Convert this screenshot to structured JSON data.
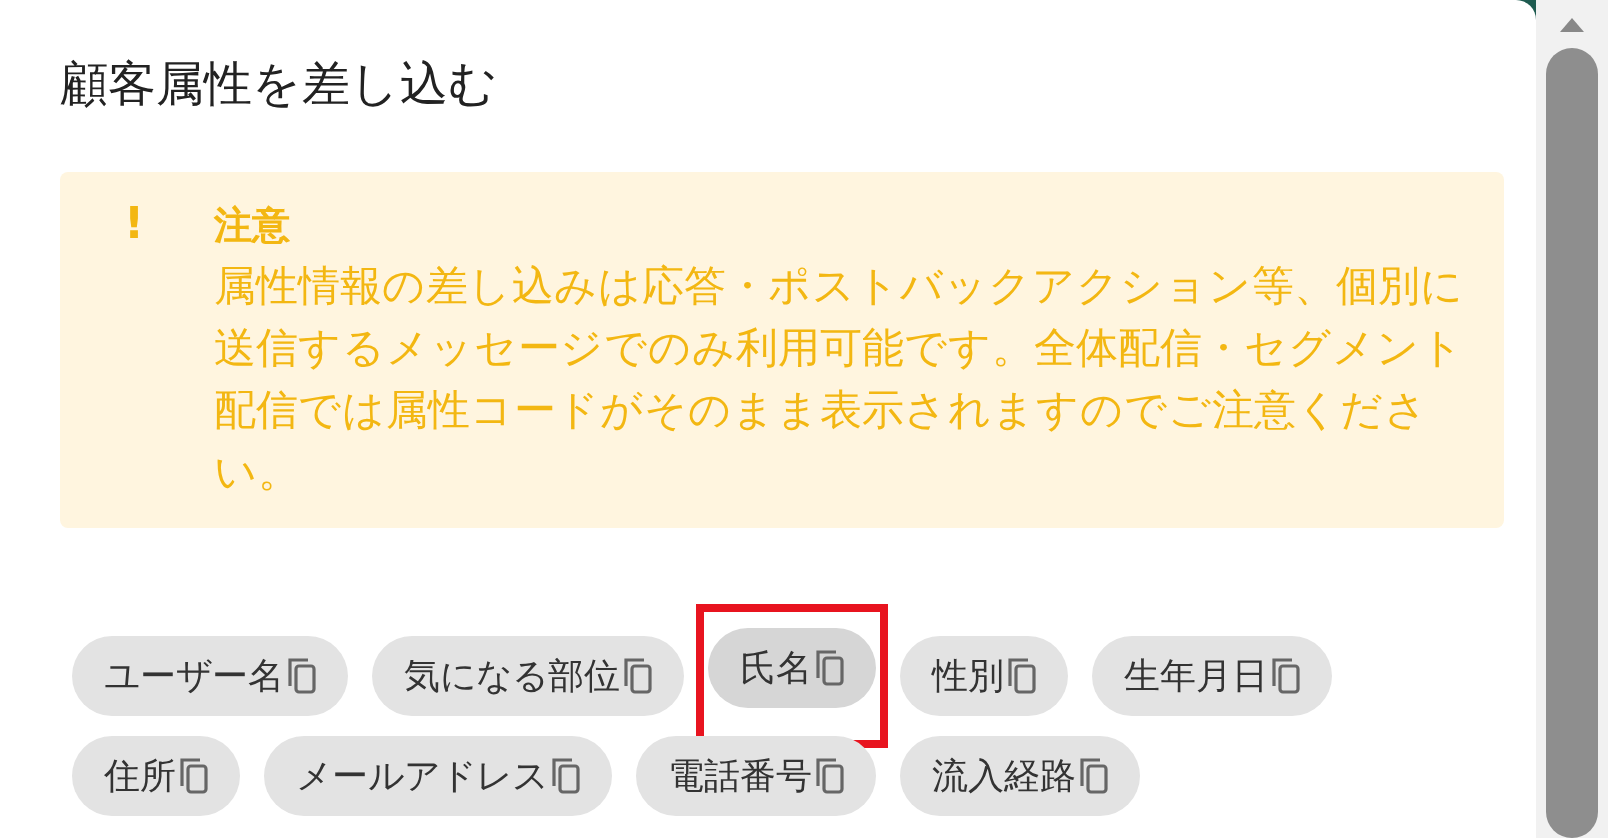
{
  "dialog": {
    "title": "顧客属性を差し込む"
  },
  "notice": {
    "icon": "!",
    "heading": "注意",
    "body": "属性情報の差し込みは応答・ポストバックアクション等、個別に送信するメッセージでのみ利用可能です。全体配信・セグメント配信では属性コードがそのまま表示されますのでご注意ください。"
  },
  "attributes": [
    {
      "label": "ユーザー名",
      "selected": false
    },
    {
      "label": "気になる部位",
      "selected": false
    },
    {
      "label": "氏名",
      "selected": true
    },
    {
      "label": "性別",
      "selected": false
    },
    {
      "label": "生年月日",
      "selected": false
    },
    {
      "label": "住所",
      "selected": false
    },
    {
      "label": "メールアドレス",
      "selected": false
    },
    {
      "label": "電話番号",
      "selected": false
    },
    {
      "label": "流入経路",
      "selected": false
    }
  ]
}
